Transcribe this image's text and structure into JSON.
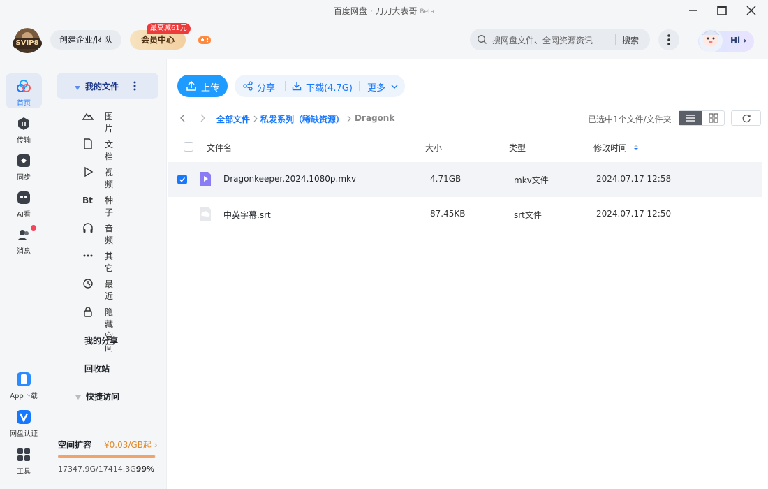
{
  "window": {
    "title": "百度网盘 · 刀刀大表哥",
    "beta": "Beta"
  },
  "header": {
    "svip": "SVIP8",
    "enterprise_btn": "创建企业/团队",
    "vip_btn": "会员中心",
    "vip_badge": "最高减61元",
    "search_placeholder": "搜网盘文件、全网资源资讯",
    "search_btn": "搜索",
    "hi": "Hi"
  },
  "rail": {
    "items": [
      {
        "label": "首页",
        "icon": "home-icon"
      },
      {
        "label": "传输",
        "icon": "transfer-icon"
      },
      {
        "label": "同步",
        "icon": "sync-icon"
      },
      {
        "label": "AI看",
        "icon": "ai-icon"
      },
      {
        "label": "消息",
        "icon": "message-icon"
      }
    ],
    "bottom": [
      {
        "label": "App下载",
        "icon": "phone-icon"
      },
      {
        "label": "网盘认证",
        "icon": "verified-icon"
      },
      {
        "label": "工具",
        "icon": "tools-icon"
      }
    ]
  },
  "nav": {
    "my_files": "我的文件",
    "subs": [
      {
        "label": "图片",
        "icon": "image-icon"
      },
      {
        "label": "文档",
        "icon": "document-icon"
      },
      {
        "label": "视频",
        "icon": "video-icon"
      },
      {
        "label": "种子",
        "icon": "torrent-icon"
      },
      {
        "label": "音频",
        "icon": "audio-icon"
      },
      {
        "label": "其它",
        "icon": "other-icon"
      },
      {
        "label": "最近",
        "icon": "recent-icon"
      },
      {
        "label": "隐藏空间",
        "icon": "lock-icon"
      }
    ],
    "my_share": "我的分享",
    "recycle": "回收站",
    "quick_access": "快捷访问",
    "storage": {
      "title": "空间扩容",
      "price": "¥0.03/GB起",
      "used": "17347.9G/17414.3G",
      "percent_text": "99%",
      "percent": 0.99
    }
  },
  "toolbar": {
    "upload": "上传",
    "share": "分享",
    "download": "下载(4.7G)",
    "more": "更多"
  },
  "breadcrumb": [
    "全部文件",
    "私发系列（稀缺资源）",
    "Dragonk"
  ],
  "selected_info": "已选中1个文件/文件夹",
  "table": {
    "headers": [
      "文件名",
      "大小",
      "类型",
      "修改时间"
    ],
    "rows": [
      {
        "name": "Dragonkeeper.2024.1080p.mkv",
        "size": "4.71GB",
        "type": "mkv文件",
        "mtime": "2024.07.17 12:58",
        "selected": true,
        "icon": "video-file-icon"
      },
      {
        "name": "中英字幕.srt",
        "size": "87.45KB",
        "type": "srt文件",
        "mtime": "2024.07.17 12:50",
        "selected": false,
        "icon": "unknown-file-icon"
      }
    ]
  }
}
